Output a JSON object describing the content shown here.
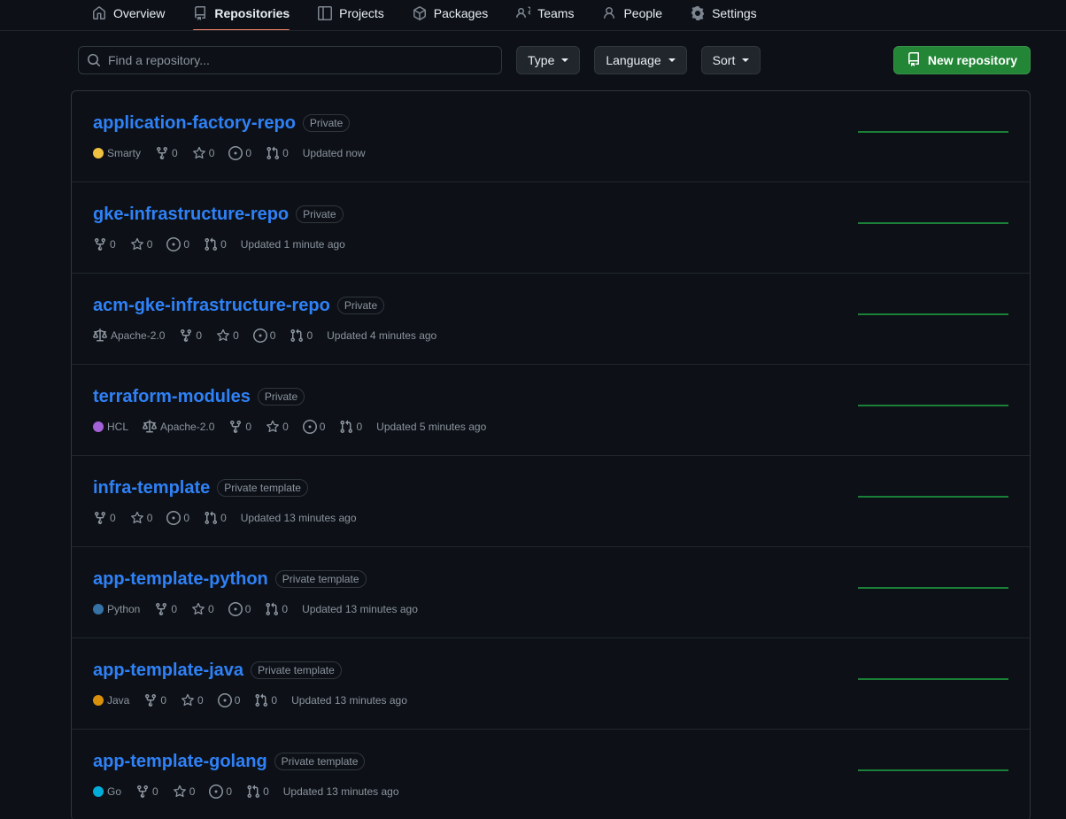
{
  "nav": {
    "tabs": [
      {
        "label": "Overview",
        "icon": "home-icon",
        "active": false
      },
      {
        "label": "Repositories",
        "icon": "repo-icon",
        "active": true
      },
      {
        "label": "Projects",
        "icon": "project-icon",
        "active": false
      },
      {
        "label": "Packages",
        "icon": "package-icon",
        "active": false
      },
      {
        "label": "Teams",
        "icon": "people-icon",
        "active": false
      },
      {
        "label": "People",
        "icon": "person-icon",
        "active": false
      },
      {
        "label": "Settings",
        "icon": "gear-icon",
        "active": false
      }
    ]
  },
  "toolbar": {
    "search_placeholder": "Find a repository...",
    "search_value": "",
    "type_label": "Type",
    "language_label": "Language",
    "sort_label": "Sort",
    "new_repo_label": "New repository"
  },
  "colors": {
    "accent_blue": "#2f81f7",
    "green_button": "#238636",
    "active_tab_underline": "#f78166",
    "muted_text": "#8b949e",
    "border": "#30363d",
    "row_divider": "#21262d",
    "page_bg": "#0d1117",
    "spark_line": "#1a7f37"
  },
  "repositories": [
    {
      "name": "application-factory-repo",
      "visibility": "Private",
      "language": "Smarty",
      "language_color": "#f0c040",
      "license": null,
      "forks": "0",
      "stars": "0",
      "issues": "0",
      "pulls": "0",
      "updated": "Updated now"
    },
    {
      "name": "gke-infrastructure-repo",
      "visibility": "Private",
      "language": null,
      "language_color": null,
      "license": null,
      "forks": "0",
      "stars": "0",
      "issues": "0",
      "pulls": "0",
      "updated": "Updated 1 minute ago"
    },
    {
      "name": "acm-gke-infrastructure-repo",
      "visibility": "Private",
      "language": null,
      "language_color": null,
      "license": "Apache-2.0",
      "forks": "0",
      "stars": "0",
      "issues": "0",
      "pulls": "0",
      "updated": "Updated 4 minutes ago"
    },
    {
      "name": "terraform-modules",
      "visibility": "Private",
      "language": "HCL",
      "language_color": "#a461d8",
      "license": "Apache-2.0",
      "forks": "0",
      "stars": "0",
      "issues": "0",
      "pulls": "0",
      "updated": "Updated 5 minutes ago"
    },
    {
      "name": "infra-template",
      "visibility": "Private template",
      "language": null,
      "language_color": null,
      "license": null,
      "forks": "0",
      "stars": "0",
      "issues": "0",
      "pulls": "0",
      "updated": "Updated 13 minutes ago"
    },
    {
      "name": "app-template-python",
      "visibility": "Private template",
      "language": "Python",
      "language_color": "#3572a5",
      "license": null,
      "forks": "0",
      "stars": "0",
      "issues": "0",
      "pulls": "0",
      "updated": "Updated 13 minutes ago"
    },
    {
      "name": "app-template-java",
      "visibility": "Private template",
      "language": "Java",
      "language_color": "#d9900b",
      "license": null,
      "forks": "0",
      "stars": "0",
      "issues": "0",
      "pulls": "0",
      "updated": "Updated 13 minutes ago"
    },
    {
      "name": "app-template-golang",
      "visibility": "Private template",
      "language": "Go",
      "language_color": "#00add8",
      "license": null,
      "forks": "0",
      "stars": "0",
      "issues": "0",
      "pulls": "0",
      "updated": "Updated 13 minutes ago"
    }
  ]
}
